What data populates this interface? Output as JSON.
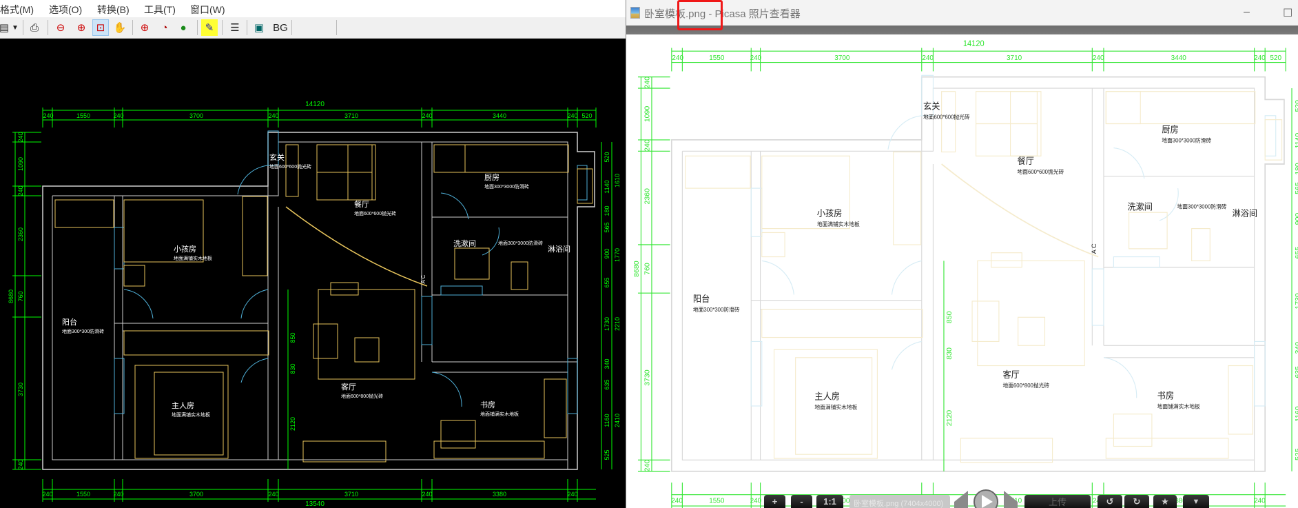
{
  "cad": {
    "menu": [
      "格式(M)",
      "选项(O)",
      "转换(B)",
      "工具(T)",
      "窗口(W)"
    ],
    "toolbar": {
      "bg_label": "BG"
    }
  },
  "plan": {
    "total_top": "14120",
    "dims_top": [
      "240",
      "1550",
      "240",
      "3700",
      "240",
      "3710",
      "240",
      "3440",
      "240",
      "520"
    ],
    "total_bottom": "13540",
    "dims_bottom": [
      "240",
      "1550",
      "240",
      "3700",
      "240",
      "3710",
      "240",
      "3380",
      "240"
    ],
    "total_left": "8680",
    "dims_left": [
      "240",
      "1090",
      "240",
      "2360",
      "760",
      "3730",
      "240"
    ],
    "dims_mid": [
      "850",
      "830",
      "2120"
    ],
    "dims_right": [
      "520",
      "1140",
      "180",
      "565",
      "900",
      "655",
      "1730",
      "340",
      "635",
      "1160",
      "525"
    ],
    "dims_right_outer": [
      "1610",
      "1770",
      "2210",
      "2410"
    ],
    "rooms": [
      {
        "name": "玄关",
        "floor": "地面600*600抛光砖"
      },
      {
        "name": "餐厅",
        "floor": "地面600*600抛光砖"
      },
      {
        "name": "厨房",
        "floor": "地面300*3000防滑砖"
      },
      {
        "name": "小孩房",
        "floor": "地面满铺实木地板"
      },
      {
        "name": "洗漱间",
        "floor": ""
      },
      {
        "name": "淋浴间",
        "floor": "地面300*3000防滑砖"
      },
      {
        "name": "阳台",
        "floor": "地面300*300防滑砖"
      },
      {
        "name": "客厅",
        "floor": "地面600*800抛光砖"
      },
      {
        "name": "书房",
        "floor": "地面铺满实木地板"
      },
      {
        "name": "主人房",
        "floor": "地面满铺实木地板"
      }
    ],
    "ac_label": "A C"
  },
  "viewer": {
    "title": "卧室模板.png - Picasa 照片查看器",
    "minimize": "–",
    "maximize": "☐",
    "caption": "卧室模板.png (7404x4000)",
    "controls": {
      "zoom_in": "+",
      "zoom_out": "-",
      "actual_size": "1:1",
      "upload": "上传",
      "rotate_left": "↺",
      "rotate_right": "↻",
      "star": "★",
      "menu": "▼"
    }
  },
  "colors": {
    "cad_bg": "#000000",
    "cad_dim": "#00ff00",
    "cad_wall": "#cfcfcf",
    "cad_furniture": "#e8c55c",
    "cad_door": "#4fb0d8",
    "annotation": "#f01818"
  }
}
